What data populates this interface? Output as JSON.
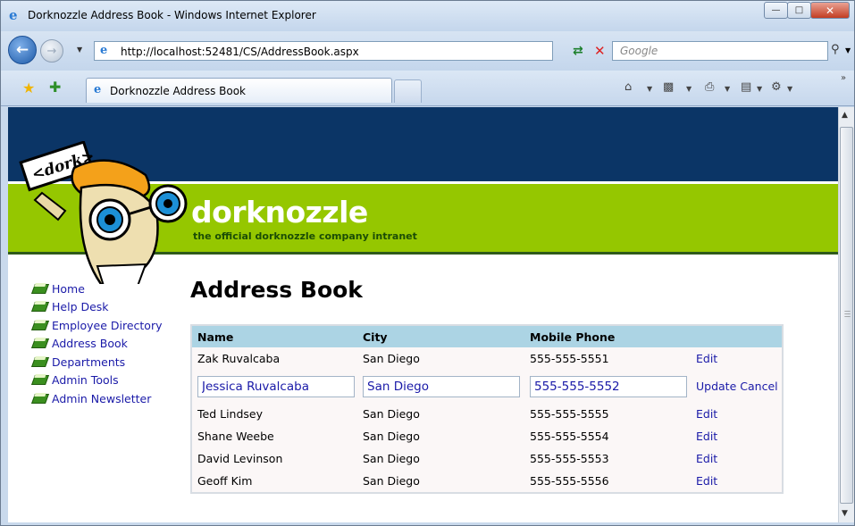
{
  "window": {
    "title": "Dorknozzle Address Book - Windows Internet Explorer"
  },
  "toolbar": {
    "address": "http://localhost:52481/CS/AddressBook.aspx",
    "search_placeholder": "Google",
    "tab_label": "Dorknozzle Address Book"
  },
  "site": {
    "brand": "dorknozzle",
    "tagline": "the official dorknozzle company intranet",
    "mascot_sign": "<dork>"
  },
  "sidebar": {
    "items": [
      {
        "label": "Home"
      },
      {
        "label": "Help Desk"
      },
      {
        "label": "Employee Directory"
      },
      {
        "label": "Address Book"
      },
      {
        "label": "Departments"
      },
      {
        "label": "Admin Tools"
      },
      {
        "label": "Admin Newsletter"
      }
    ]
  },
  "main": {
    "heading": "Address Book",
    "columns": [
      "Name",
      "City",
      "Mobile Phone"
    ],
    "edit_label": "Edit",
    "update_label": "Update",
    "cancel_label": "Cancel",
    "rows": [
      {
        "name": "Zak Ruvalcaba",
        "city": "San Diego",
        "phone": "555-555-5551"
      },
      {
        "name": "Jessica Ruvalcaba",
        "city": "San Diego",
        "phone": "555-555-5552",
        "editing": true
      },
      {
        "name": "Ted Lindsey",
        "city": "San Diego",
        "phone": "555-555-5555"
      },
      {
        "name": "Shane Weebe",
        "city": "San Diego",
        "phone": "555-555-5554"
      },
      {
        "name": "David Levinson",
        "city": "San Diego",
        "phone": "555-555-5553"
      },
      {
        "name": "Geoff Kim",
        "city": "San Diego",
        "phone": "555-555-5556"
      }
    ]
  },
  "colors": {
    "header_navy": "#0b3566",
    "header_green": "#95c700",
    "grid_header": "#acd4e4",
    "link": "#1a1aa8"
  }
}
